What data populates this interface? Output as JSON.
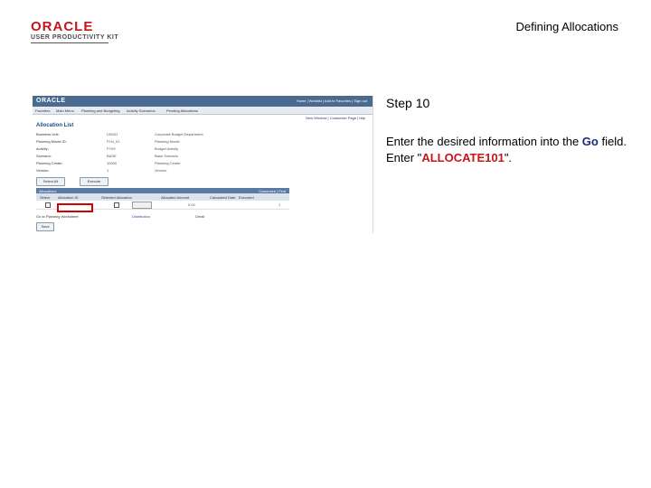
{
  "header": {
    "logo_oracle": "ORACLE",
    "logo_subtitle": "USER PRODUCTIVITY KIT",
    "doc_title": "Defining Allocations"
  },
  "screenshot": {
    "brand": "ORACLE",
    "top_links": "Home   |   Worklist   |   Add to Favorites   |   Sign out",
    "menu_items": [
      "Favorites",
      "Main Menu",
      "Planning and Budgeting",
      "Activity Scenarios",
      "Pending Allocations"
    ],
    "tools": "New Window   |   Customize Page   |   http",
    "page_title": "Allocation List",
    "fields": [
      {
        "label": "Business Unit:",
        "value": "US001",
        "desc": "Corporate Budget Department"
      },
      {
        "label": "Planning Model ID:",
        "value": "PLN_01",
        "desc": "Planning Model"
      },
      {
        "label": "Activity:",
        "value": "FY09",
        "desc": "Budget Activity"
      },
      {
        "label": "Scenario:",
        "value": "BASE",
        "desc": "Base Scenario"
      },
      {
        "label": "Planning Center:",
        "value": "10000",
        "desc": "Planning Center"
      },
      {
        "label": "Version:",
        "value": "1",
        "desc": "Version"
      }
    ],
    "select_all": "Select All",
    "execute": "Execute",
    "grid_title": "Allocations",
    "grid_nav": "Customize | Find",
    "columns": [
      "Select",
      "Allocation ID",
      "Selected Allocation",
      "Allocated Amount",
      "Calculated Date",
      "Executed"
    ],
    "row_amount": "0.00",
    "row_count": "1",
    "footer_label": "Go to Planning Worksheet",
    "footer_link1": "Distribution",
    "footer_link2": "Detail",
    "save_button": "Save"
  },
  "step": {
    "title": "Step 10",
    "instruction_pre": "Enter the desired information into the ",
    "field_name": "Go",
    "instruction_mid": " field. Enter \"",
    "value": "ALLOCATE101",
    "instruction_post": "\"."
  }
}
